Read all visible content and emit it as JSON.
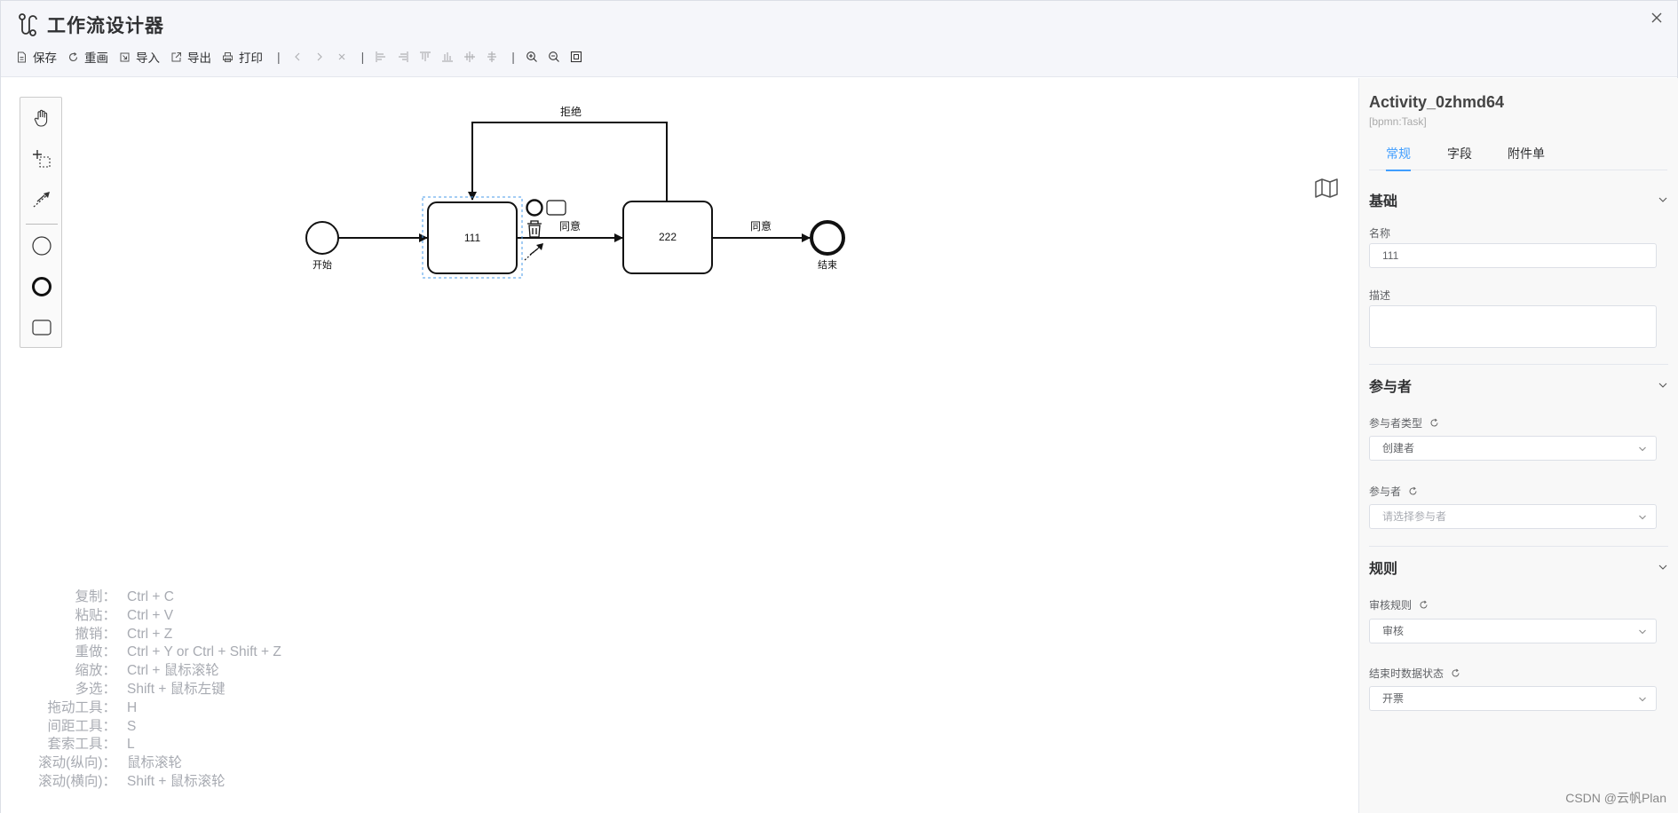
{
  "app": {
    "title": "工作流设计器"
  },
  "toolbar": {
    "save": "保存",
    "redraw": "重画",
    "import": "导入",
    "export": "导出",
    "print": "打印",
    "separator": "|"
  },
  "diagram": {
    "start_label": "开始",
    "end_label": "结束",
    "task1_label": "111",
    "task2_label": "222",
    "flow_agree1": "同意",
    "flow_agree2": "同意",
    "flow_reject": "拒绝"
  },
  "shortcuts": [
    {
      "key": "复制：",
      "value": "Ctrl + C"
    },
    {
      "key": "粘贴：",
      "value": "Ctrl + V"
    },
    {
      "key": "撤销：",
      "value": "Ctrl + Z"
    },
    {
      "key": "重做：",
      "value": "Ctrl + Y or Ctrl + Shift + Z"
    },
    {
      "key": "缩放：",
      "value": "Ctrl + 鼠标滚轮"
    },
    {
      "key": "多选：",
      "value": "Shift + 鼠标左键"
    },
    {
      "key": "拖动工具：",
      "value": "H"
    },
    {
      "key": "间距工具：",
      "value": "S"
    },
    {
      "key": "套索工具：",
      "value": "L"
    },
    {
      "key": "滚动(纵向)：",
      "value": "鼠标滚轮"
    },
    {
      "key": "滚动(横向)：",
      "value": "Shift + 鼠标滚轮"
    }
  ],
  "panel": {
    "element_id": "Activity_0zhmd64",
    "element_type": "[bpmn:Task]",
    "tabs": [
      "常规",
      "字段",
      "附件单"
    ],
    "basic": {
      "title": "基础",
      "name_label": "名称",
      "name_value": "111",
      "desc_label": "描述",
      "desc_value": ""
    },
    "participants": {
      "title": "参与者",
      "type_label": "参与者类型",
      "type_value": "创建者",
      "participant_label": "参与者",
      "participant_placeholder": "请选择参与者"
    },
    "rules": {
      "title": "规则",
      "review_label": "审核规则",
      "review_value": "审核",
      "end_state_label": "结束时数据状态",
      "end_state_value": "开票"
    }
  },
  "watermark": "CSDN @云帆Plan",
  "colors": {
    "accent": "#409eff",
    "selection": "#4a9be8"
  }
}
